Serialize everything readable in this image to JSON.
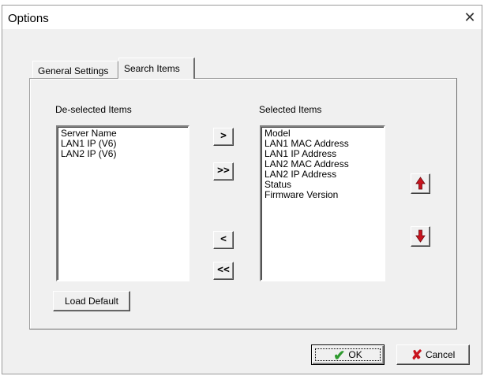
{
  "window": {
    "title": "Options",
    "close_glyph": "✕"
  },
  "tabs": [
    {
      "label": "General Settings",
      "active": false
    },
    {
      "label": "Search Items",
      "active": true
    }
  ],
  "deselected": {
    "label": "De-selected Items",
    "items": [
      "Server Name",
      "LAN1 IP (V6)",
      "LAN2 IP (V6)"
    ]
  },
  "selected": {
    "label": "Selected Items",
    "items": [
      "Model",
      "LAN1 MAC Address",
      "LAN1 IP Address",
      "LAN2 MAC Address",
      "LAN2 IP Address",
      "Status",
      "Firmware Version"
    ]
  },
  "transfer_buttons": {
    "add": ">",
    "add_all": ">>",
    "remove": "<",
    "remove_all": "<<"
  },
  "load_default_label": "Load Default",
  "ok_label": "OK",
  "cancel_label": "Cancel",
  "icons": {
    "move_up": "arrow-up-icon",
    "move_down": "arrow-down-icon",
    "ok": "check-icon",
    "cancel": "x-icon"
  },
  "colors": {
    "arrow": "#c8141e",
    "check": "#2e9a2e",
    "cancel_x": "#c8141e"
  }
}
